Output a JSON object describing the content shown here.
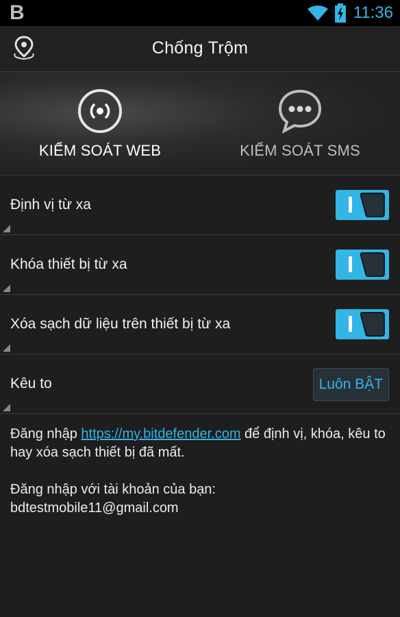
{
  "status_bar": {
    "logo": "B",
    "time": "11:36",
    "icons": [
      "wifi-icon",
      "battery-charging-icon"
    ]
  },
  "header": {
    "title": "Chống Trộm",
    "icon": "location-pin-icon"
  },
  "tabs": [
    {
      "label": "KIỂM SOÁT WEB",
      "icon": "broadcast-icon",
      "selected": true
    },
    {
      "label": "KIỂM SOÁT SMS",
      "icon": "chat-bubble-icon",
      "selected": false
    }
  ],
  "settings": {
    "locate": {
      "label": "Định vị từ xa",
      "state": "I"
    },
    "lock": {
      "label": "Khóa thiết bị từ xa",
      "state": "I"
    },
    "wipe": {
      "label": "Xóa sạch dữ liệu trên thiết bị từ xa",
      "state": "I"
    },
    "scream": {
      "label": "Kêu to",
      "value": "Luôn BẬT"
    }
  },
  "info": {
    "line1_prefix": "Đăng nhập ",
    "link": "https://my.bitdefender.com",
    "line1_suffix": " để định vị, khóa, kêu to hay xóa sạch thiết bị đã mất.",
    "account_label": "Đăng nhập với tài khoản của bạn:",
    "account_email": "bdtestmobile11@gmail.com"
  },
  "colors": {
    "accent": "#33b5e5",
    "background": "#1e1e1e",
    "divider": "#3b3b3b"
  }
}
